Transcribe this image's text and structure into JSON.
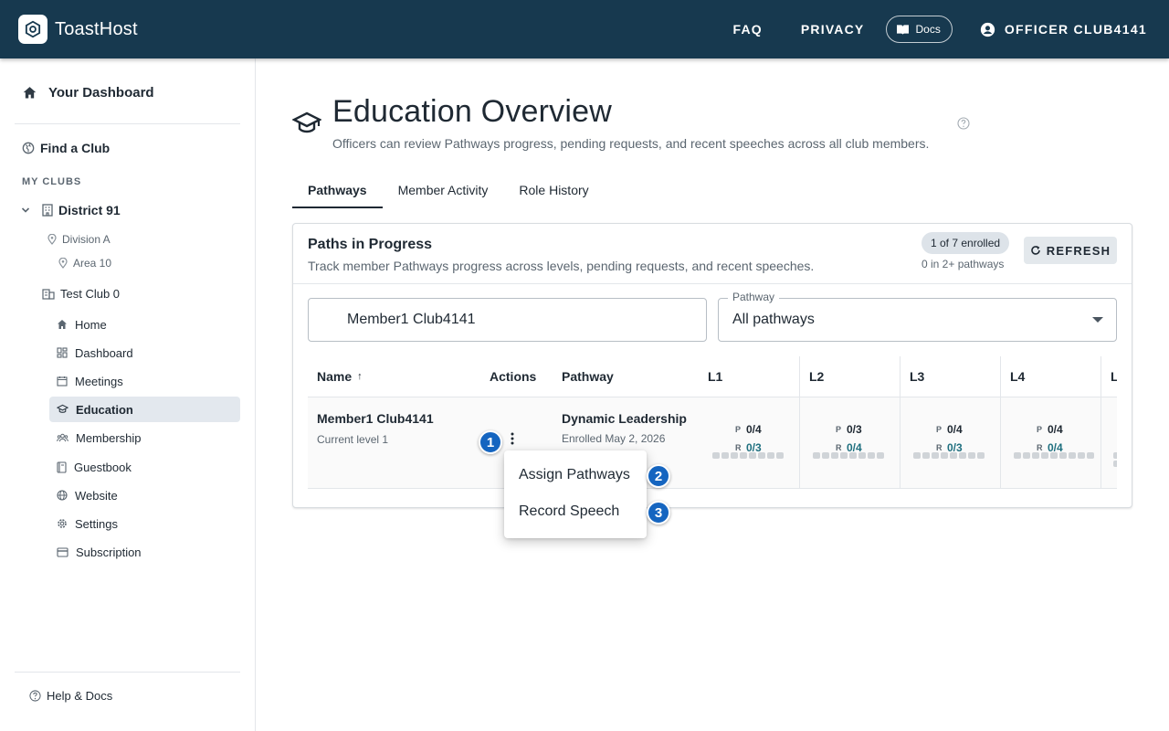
{
  "app": {
    "name": "ToastHost"
  },
  "topnav": {
    "faq": "FAQ",
    "privacy": "PRIVACY",
    "docs": "Docs",
    "account": "OFFICER CLUB4141"
  },
  "sidebar": {
    "dashboard": "Your Dashboard",
    "find_club": "Find a Club",
    "section": "MY CLUBS",
    "district": "District 91",
    "division": "Division A",
    "area": "Area 10",
    "club": "Test Club 0",
    "items": [
      {
        "label": "Home",
        "icon": "home-icon"
      },
      {
        "label": "Dashboard",
        "icon": "dashboard-icon"
      },
      {
        "label": "Meetings",
        "icon": "calendar-icon"
      },
      {
        "label": "Education",
        "icon": "graduation-cap-icon",
        "active": true
      },
      {
        "label": "Membership",
        "icon": "people-icon"
      },
      {
        "label": "Guestbook",
        "icon": "book-icon"
      },
      {
        "label": "Website",
        "icon": "globe-icon"
      },
      {
        "label": "Settings",
        "icon": "gear-icon"
      },
      {
        "label": "Subscription",
        "icon": "credit-card-icon"
      }
    ],
    "help": "Help & Docs"
  },
  "page": {
    "title": "Education Overview",
    "subtitle": "Officers can review Pathways progress, pending requests, and recent speeches across all club members."
  },
  "tabs": [
    {
      "label": "Pathways",
      "active": true
    },
    {
      "label": "Member Activity"
    },
    {
      "label": "Role History"
    }
  ],
  "card": {
    "title": "Paths in Progress",
    "subtitle": "Track member Pathways progress across levels, pending requests, and recent speeches.",
    "chip": "1 of 7 enrolled",
    "chip_note": "0 in 2+ pathways",
    "refresh": "REFRESH"
  },
  "filters": {
    "search_value": "Member1 Club4141",
    "pathway_label": "Pathway",
    "pathway_value": "All pathways"
  },
  "table": {
    "headers": {
      "name": "Name",
      "sort": "↑",
      "actions": "Actions",
      "pathway": "Pathway",
      "levels": [
        "L1",
        "L2",
        "L3",
        "L4",
        "L"
      ]
    },
    "rows": [
      {
        "name": "Member1 Club4141",
        "level": "Current level 1",
        "pathway": "Dynamic Leadership",
        "enrolled": "Enrolled May 2, 2026",
        "levels": [
          {
            "p_key": "P",
            "p": "0/4",
            "r_key": "R",
            "r": "0/3"
          },
          {
            "p_key": "P",
            "p": "0/3",
            "r_key": "R",
            "r": "0/4"
          },
          {
            "p_key": "P",
            "p": "0/4",
            "r_key": "R",
            "r": "0/3"
          },
          {
            "p_key": "P",
            "p": "0/4",
            "r_key": "R",
            "r": "0/4"
          }
        ]
      }
    ]
  },
  "menu": {
    "items": [
      "Assign Pathways",
      "Record Speech"
    ]
  },
  "badges": [
    "1",
    "2",
    "3"
  ],
  "colors": {
    "topbar": "#17394f",
    "accent_teal": "#1e6f7f",
    "badge": "#1565c0",
    "active_nav": "#e3e8ee"
  }
}
